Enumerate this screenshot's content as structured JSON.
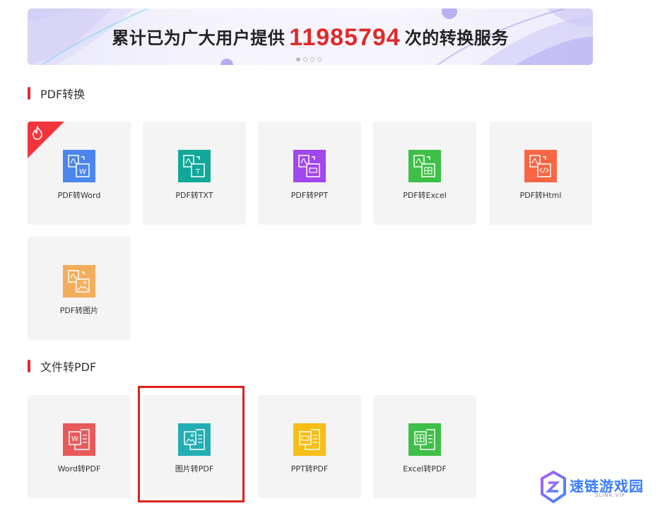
{
  "banner": {
    "text_before": "累计已为广大用户提供",
    "count": "11985794",
    "text_after": "次的转换服务",
    "accent": "#e02a2a"
  },
  "sections": {
    "pdf_convert": {
      "title": "PDF转换"
    },
    "file_to_pdf": {
      "title": "文件转PDF"
    }
  },
  "tiles": {
    "pdf_word": {
      "label": "PDF转Word",
      "color": "#4a86ee",
      "icon": "pdf-to-word-icon",
      "hot": true
    },
    "pdf_txt": {
      "label": "PDF转TXT",
      "color": "#11a89a",
      "icon": "pdf-to-txt-icon"
    },
    "pdf_ppt": {
      "label": "PDF转PPT",
      "color": "#a147ee",
      "icon": "pdf-to-ppt-icon"
    },
    "pdf_excel": {
      "label": "PDF转Excel",
      "color": "#3ebf47",
      "icon": "pdf-to-excel-icon"
    },
    "pdf_html": {
      "label": "PDF转Html",
      "color": "#f86644",
      "icon": "pdf-to-html-icon"
    },
    "pdf_img": {
      "label": "PDF转图片",
      "color": "#f4ad5c",
      "icon": "pdf-to-image-icon"
    },
    "word_pdf": {
      "label": "Word转PDF",
      "color": "#e85a5a",
      "icon": "word-to-pdf-icon"
    },
    "img_pdf": {
      "label": "图片转PDF",
      "color": "#23aeb5",
      "icon": "image-to-pdf-icon"
    },
    "ppt_pdf": {
      "label": "PPT转PDF",
      "color": "#f7be16",
      "icon": "ppt-to-pdf-icon"
    },
    "excel_pdf": {
      "label": "Excel转PDF",
      "color": "#3ebf47",
      "icon": "excel-to-pdf-icon"
    }
  },
  "watermark": {
    "text": "速链游戏园",
    "sub": "SLINK.VIP"
  },
  "colors": {
    "section_bar": "#e4282b",
    "tile_bg": "#f4f4f4",
    "highlight": "#e0201f"
  }
}
